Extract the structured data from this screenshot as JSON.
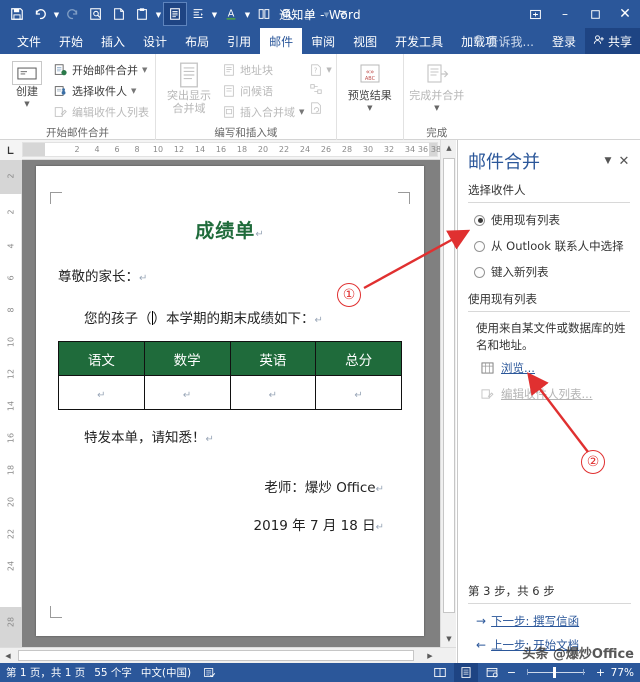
{
  "window": {
    "title": "通知单 - Word",
    "controls": [
      {
        "name": "ribbon-display-options",
        "glyph": "⧉"
      },
      {
        "name": "minimize",
        "glyph": "–"
      },
      {
        "name": "restore",
        "glyph": "☐"
      },
      {
        "name": "close",
        "glyph": "✕"
      }
    ]
  },
  "quick_access": [
    {
      "name": "save-icon",
      "glyph": "💾",
      "state": "enabled",
      "caret": false
    },
    {
      "name": "undo-icon",
      "glyph": "↶",
      "state": "enabled",
      "caret": true
    },
    {
      "name": "redo-icon",
      "glyph": "↻",
      "state": "disabled",
      "caret": false
    },
    {
      "name": "print-preview-icon",
      "glyph": "⌕",
      "state": "enabled",
      "caret": false
    },
    {
      "name": "new-document-icon",
      "glyph": "▯",
      "state": "enabled",
      "caret": false
    },
    {
      "name": "paste-icon",
      "glyph": "📋",
      "state": "enabled",
      "caret": true
    },
    {
      "name": "document-view-icon",
      "glyph": "☰",
      "state": "selected",
      "caret": false
    },
    {
      "name": "paragraph-indent-icon",
      "glyph": "≡",
      "state": "enabled",
      "caret": true
    },
    {
      "name": "font-color-icon",
      "glyph": "A",
      "state": "enabled",
      "caret": true
    },
    {
      "name": "columns-icon",
      "glyph": "▤",
      "state": "enabled",
      "caret": false
    },
    {
      "name": "find-icon",
      "glyph": "🔍",
      "state": "enabled",
      "caret": false
    },
    {
      "name": "highlight-icon",
      "glyph": "▱",
      "state": "disabled",
      "caret": true
    },
    {
      "name": "customize-qat-icon",
      "glyph": "≡",
      "state": "enabled",
      "caret": false
    }
  ],
  "tabs": [
    {
      "label": "文件",
      "active": false
    },
    {
      "label": "开始",
      "active": false
    },
    {
      "label": "插入",
      "active": false
    },
    {
      "label": "设计",
      "active": false
    },
    {
      "label": "布局",
      "active": false
    },
    {
      "label": "引用",
      "active": false
    },
    {
      "label": "邮件",
      "active": true
    },
    {
      "label": "审阅",
      "active": false
    },
    {
      "label": "视图",
      "active": false
    },
    {
      "label": "开发工具",
      "active": false
    },
    {
      "label": "加载项",
      "active": false
    }
  ],
  "tab_right": {
    "tell_me": "告诉我...",
    "tell_me_icon": "lightbulb-icon",
    "sign_in": "登录",
    "share": "共享",
    "share_icon": "share-person-icon"
  },
  "ribbon": {
    "groups": [
      {
        "title": "开始邮件合并",
        "big_buttons": [
          {
            "label": "创建",
            "icon": "envelope-icon",
            "caret": true,
            "disabled": false
          }
        ],
        "small_buttons": [
          {
            "label": "开始邮件合并",
            "icon": "mail-merge-icon",
            "caret": true,
            "disabled": false
          },
          {
            "label": "选择收件人",
            "icon": "select-recipients-icon",
            "caret": true,
            "disabled": false
          },
          {
            "label": "编辑收件人列表",
            "icon": "edit-recipients-icon",
            "caret": false,
            "disabled": true
          }
        ]
      },
      {
        "title": "编写和插入域",
        "big_buttons": [
          {
            "label": "突出显示\n合并域",
            "icon": "highlight-merge-fields-icon",
            "caret": false,
            "disabled": true
          }
        ],
        "small_buttons": [
          {
            "label": "地址块",
            "icon": "address-block-icon",
            "caret": false,
            "disabled": true
          },
          {
            "label": "问候语",
            "icon": "greeting-line-icon",
            "caret": false,
            "disabled": true
          },
          {
            "label": "插入合并域",
            "icon": "insert-merge-field-icon",
            "caret": true,
            "disabled": true
          }
        ],
        "icon_column": [
          {
            "name": "rules-icon",
            "glyph": "▧",
            "caret": true
          },
          {
            "name": "match-fields-icon",
            "glyph": "⌨",
            "caret": false
          },
          {
            "name": "update-labels-icon",
            "glyph": "↻",
            "caret": false
          }
        ]
      },
      {
        "title": "",
        "big_buttons": [
          {
            "label": "预览结果",
            "icon": "preview-results-abc-icon",
            "caret": true,
            "disabled": false
          }
        ],
        "small_buttons": []
      },
      {
        "title": "完成",
        "big_buttons": [
          {
            "label": "完成并合并",
            "icon": "finish-merge-icon",
            "caret": true,
            "disabled": true
          }
        ],
        "small_buttons": []
      }
    ]
  },
  "ruler": {
    "corner_icon": "tab-stop-left-icon",
    "horizontal_ticks": [
      2,
      4,
      6,
      8,
      10,
      12,
      14,
      16,
      18,
      20,
      22,
      24,
      26,
      28,
      30,
      32,
      34,
      36,
      38
    ],
    "vertical_ticks": [
      2,
      2,
      4,
      6,
      8,
      10,
      12,
      14,
      16,
      18,
      20,
      22,
      24,
      28
    ]
  },
  "document": {
    "title": "成绩单",
    "salutation": "尊敬的家长：",
    "body_prefix": "您的孩子（",
    "body_suffix": "）本学期的期末成绩如下：",
    "table": {
      "headers": [
        "语文",
        "数学",
        "英语",
        "总分"
      ],
      "rows": [
        [
          "",
          "",
          "",
          ""
        ]
      ]
    },
    "closing": "特发本单，请知悉！",
    "signature": "老师：爆炒 Office",
    "date": "2019 年 7 月 18 日",
    "pilcrow": "↵"
  },
  "task_pane": {
    "title": "邮件合并",
    "dropdown_icon": "chevron-down-icon",
    "close_icon": "close-icon",
    "section1_label": "选择收件人",
    "radios": [
      {
        "label": "使用现有列表",
        "selected": true
      },
      {
        "label": "从 Outlook 联系人中选择",
        "selected": false
      },
      {
        "label": "键入新列表",
        "selected": false
      }
    ],
    "section2_label": "使用现有列表",
    "description": "使用来自某文件或数据库的姓名和地址。",
    "links": [
      {
        "label": "浏览...",
        "icon": "browse-table-icon",
        "disabled": false
      },
      {
        "label": "编辑收件人列表...",
        "icon": "edit-recipients-icon",
        "disabled": true
      }
    ],
    "step_text": "第 3 步，共 6 步",
    "next_link": "下一步: 撰写信函",
    "prev_link": "上一步: 开始文档",
    "next_arrow": "→",
    "prev_arrow": "←"
  },
  "status_bar": {
    "page_info": "第 1 页，共 1 页",
    "word_count": "55 个字",
    "language": "中文(中国)",
    "proofing_icon": "proofing-icon",
    "views": [
      {
        "name": "read-mode-icon",
        "glyph": "▤",
        "active": false
      },
      {
        "name": "print-layout-icon",
        "glyph": "☰",
        "active": true
      },
      {
        "name": "web-layout-icon",
        "glyph": "▦",
        "active": false
      }
    ],
    "zoom_out": "−",
    "zoom_in": "+",
    "zoom_value": "77%"
  },
  "annotations": [
    {
      "label": "①",
      "name": "annotation-1"
    },
    {
      "label": "②",
      "name": "annotation-2"
    }
  ],
  "watermark": "头条 @爆炒Office",
  "colors": {
    "brand_blue": "#2b579a",
    "doc_green": "#1f6b3b",
    "annotation_red": "#e03030",
    "link_blue": "#2b579a"
  }
}
